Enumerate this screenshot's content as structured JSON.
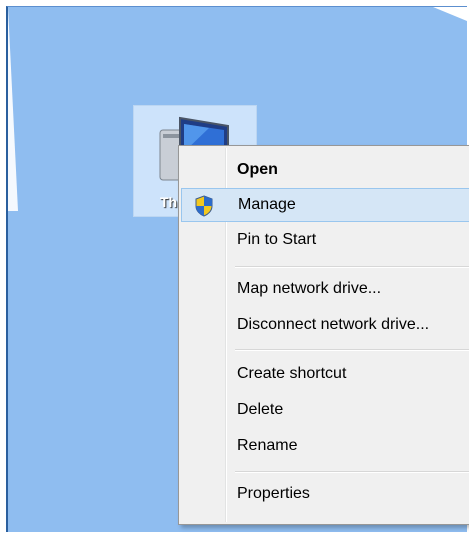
{
  "desktop": {
    "background_color": "#8fbdf0",
    "icon": {
      "label": "Th",
      "icon_name": "computer-icon",
      "selected": true
    }
  },
  "context_menu": {
    "items": [
      {
        "label": "Open",
        "bold": true,
        "highlighted": false,
        "icon": null
      },
      {
        "label": "Manage",
        "bold": false,
        "highlighted": true,
        "icon": "uac-shield-icon"
      },
      {
        "label": "Pin to Start",
        "bold": false,
        "highlighted": false,
        "icon": null
      },
      {
        "label": "Map network drive...",
        "bold": false,
        "highlighted": false,
        "icon": null
      },
      {
        "label": "Disconnect network drive...",
        "bold": false,
        "highlighted": false,
        "icon": null
      },
      {
        "label": "Create shortcut",
        "bold": false,
        "highlighted": false,
        "icon": null
      },
      {
        "label": "Delete",
        "bold": false,
        "highlighted": false,
        "icon": null
      },
      {
        "label": "Rename",
        "bold": false,
        "highlighted": false,
        "icon": null
      },
      {
        "label": "Properties",
        "bold": false,
        "highlighted": false,
        "icon": null
      }
    ],
    "colors": {
      "background": "#f0f0f0",
      "highlight": "#d5e6f6",
      "highlight_border": "#99c6ee"
    }
  }
}
